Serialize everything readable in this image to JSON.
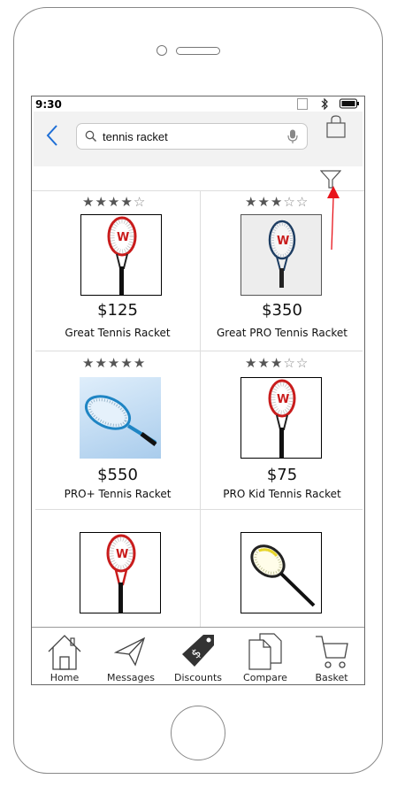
{
  "status": {
    "time": "9:30"
  },
  "search": {
    "query": "tennis racket"
  },
  "products": [
    {
      "rating": 4,
      "price": "$125",
      "name": "Great Tennis Racket"
    },
    {
      "rating": 3,
      "price": "$350",
      "name": "Great PRO Tennis Racket"
    },
    {
      "rating": 5,
      "price": "$550",
      "name": "PRO+ Tennis Racket"
    },
    {
      "rating": 3,
      "price": "$75",
      "name": "PRO Kid Tennis Racket"
    },
    {
      "rating": null,
      "price": "",
      "name": ""
    },
    {
      "rating": null,
      "price": "",
      "name": ""
    }
  ],
  "tabs": [
    {
      "label": "Home",
      "icon": "home-icon"
    },
    {
      "label": "Messages",
      "icon": "paper-plane-icon"
    },
    {
      "label": "Discounts",
      "icon": "price-tag-icon"
    },
    {
      "label": "Compare",
      "icon": "documents-icon"
    },
    {
      "label": "Basket",
      "icon": "cart-icon"
    }
  ],
  "colors": {
    "accent": "#1f6fd6",
    "annotation": "#e8141b",
    "racket_red": "#d7261e"
  }
}
